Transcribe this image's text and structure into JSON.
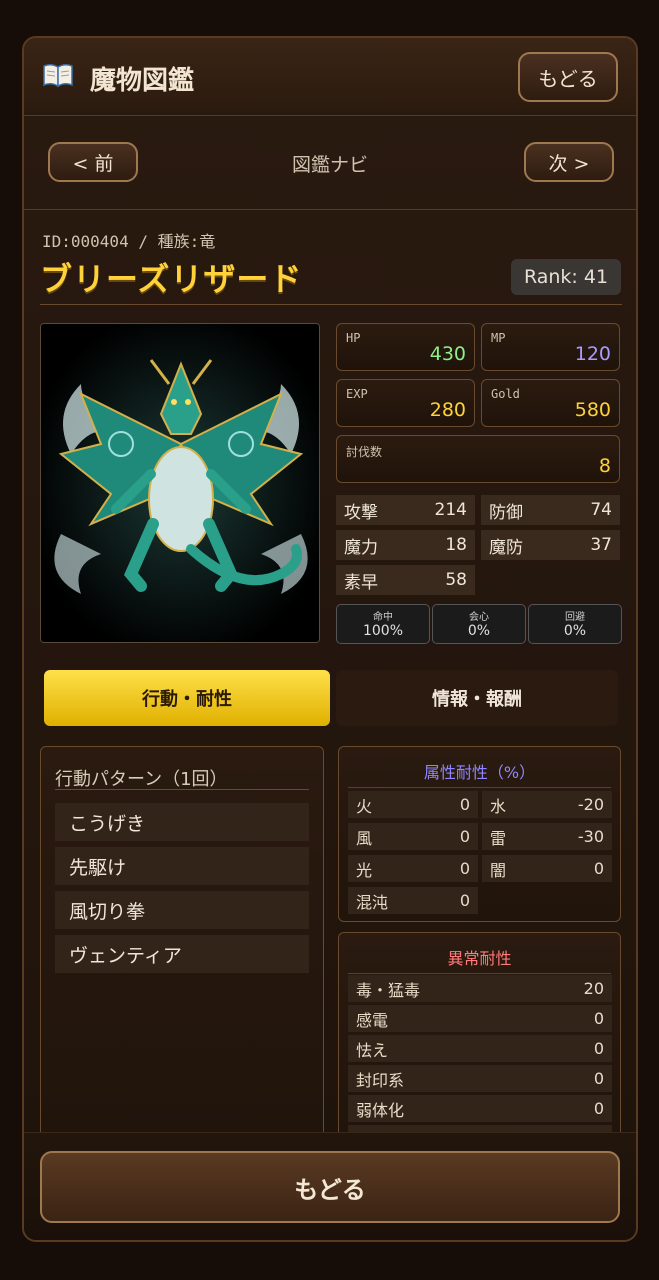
{
  "header": {
    "title": "魔物図鑑",
    "back_label": "もどる",
    "icon": "book-icon"
  },
  "nav": {
    "prev_label": "< 前",
    "title": "図鑑ナビ",
    "next_label": "次 >"
  },
  "monster": {
    "meta": "ID:000404 / 種族:竜",
    "name": "ブリーズリザード",
    "rank": "Rank: 41",
    "portrait": "wind-dragon-image"
  },
  "stats": {
    "hp": {
      "label": "HP",
      "value": "430",
      "color": "#8ff08a"
    },
    "mp": {
      "label": "MP",
      "value": "120",
      "color": "#a89cff"
    },
    "exp": {
      "label": "EXP",
      "value": "280",
      "color": "#ffd23a"
    },
    "gold": {
      "label": "Gold",
      "value": "580",
      "color": "#ffd23a"
    },
    "kills": {
      "label": "討伐数",
      "value": "8",
      "color": "#ffd23a"
    },
    "attack": {
      "label": "攻撃",
      "value": "214"
    },
    "defense": {
      "label": "防御",
      "value": "74"
    },
    "magic": {
      "label": "魔力",
      "value": "18"
    },
    "mdef": {
      "label": "魔防",
      "value": "37"
    },
    "speed": {
      "label": "素早",
      "value": "58"
    },
    "hit": {
      "label": "命中",
      "value": "100%"
    },
    "crit": {
      "label": "会心",
      "value": "0%"
    },
    "evade": {
      "label": "回避",
      "value": "0%"
    }
  },
  "tabs": {
    "active": "行動・耐性",
    "inactive": "情報・報酬"
  },
  "actions": {
    "title": "行動パターン（1回）",
    "items": [
      "こうげき",
      "先駆け",
      "風切り拳",
      "ヴェンティア"
    ]
  },
  "elemental": {
    "title": "属性耐性（%）",
    "title_color": "#8f86ff",
    "rows": [
      {
        "name": "火",
        "value": "0"
      },
      {
        "name": "水",
        "value": "-20"
      },
      {
        "name": "風",
        "value": "0"
      },
      {
        "name": "雷",
        "value": "-30"
      },
      {
        "name": "光",
        "value": "0"
      },
      {
        "name": "闇",
        "value": "0"
      },
      {
        "name": "混沌",
        "value": "0"
      }
    ]
  },
  "status": {
    "title": "異常耐性",
    "title_color": "#ff7a7a",
    "rows": [
      {
        "name": "毒・猛毒",
        "value": "20"
      },
      {
        "name": "感電",
        "value": "0"
      },
      {
        "name": "怯え",
        "value": "0"
      },
      {
        "name": "封印系",
        "value": "0"
      },
      {
        "name": "弱体化",
        "value": "0"
      }
    ]
  },
  "footer": {
    "back_label": "もどる"
  }
}
